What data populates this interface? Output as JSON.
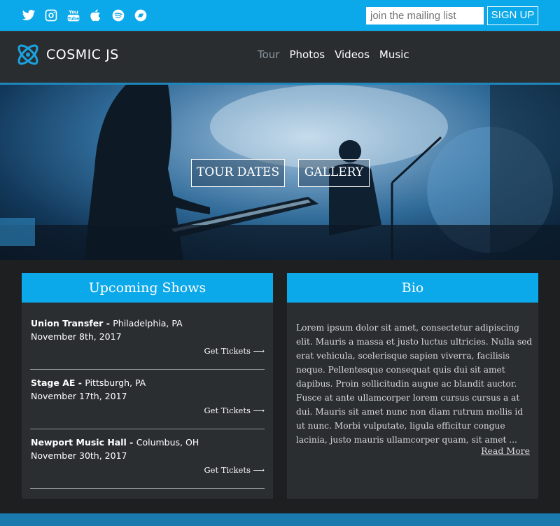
{
  "social": {
    "icons": [
      "twitter-icon",
      "instagram-icon",
      "youtube-icon",
      "apple-icon",
      "spotify-icon",
      "bandsintown-icon"
    ],
    "youtube_text": "You Tube"
  },
  "mailing": {
    "placeholder": "join the mailing list",
    "signup_label": "SIGN UP"
  },
  "brand": {
    "name": "COSMIC JS"
  },
  "nav": {
    "items": [
      {
        "label": "Tour",
        "active": true
      },
      {
        "label": "Photos",
        "active": false
      },
      {
        "label": "Videos",
        "active": false
      },
      {
        "label": "Music",
        "active": false
      }
    ]
  },
  "hero": {
    "tour_dates_label": "TOUR DATES",
    "gallery_label": "GALLERY"
  },
  "shows": {
    "title": "Upcoming Shows",
    "items": [
      {
        "venue": "Union Transfer",
        "separator": " - ",
        "city": "Philadelphia, PA",
        "date": "November 8th, 2017",
        "tickets": "Get Tickets ⟶"
      },
      {
        "venue": "Stage AE",
        "separator": " - ",
        "city": "Pittsburgh, PA",
        "date": "November 17th, 2017",
        "tickets": "Get Tickets ⟶"
      },
      {
        "venue": "Newport Music Hall",
        "separator": " - ",
        "city": "Columbus, OH",
        "date": "November 30th, 2017",
        "tickets": "Get Tickets ⟶"
      }
    ]
  },
  "bio": {
    "title": "Bio",
    "text": "Lorem ipsum dolor sit amet, consectetur adipiscing elit. Mauris a massa et justo luctus ultricies. Nulla sed erat vehicula, scelerisque sapien viverra, facilisis neque. Pellentesque consequat quis dui sit amet dapibus. Proin sollicitudin augue ac blandit auctor. Fusce at ante ullamcorper lorem cursus cursus a at dui. Mauris sit amet nunc non diam rutrum mollis id ut nunc. Morbi vulputate, ligula efficitur congue lacinia, justo mauris ullamcorper quam, sit amet ...",
    "read_more": "Read More"
  },
  "colors": {
    "accent": "#0ba8ea",
    "nav_bg": "#2a2d30",
    "panel_bg": "#2b2e31",
    "page_bg": "#1d1f21",
    "footer": "#1a7aae"
  }
}
